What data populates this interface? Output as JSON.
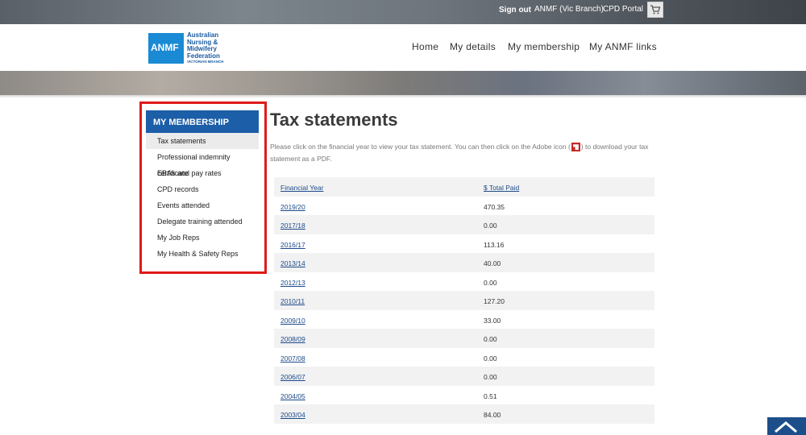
{
  "topbar": {
    "sign_out": "Sign out",
    "branch_link": "ANMF (Vic Branch)",
    "cpd_link": "CPD Portal",
    "cart_icon": "cart-icon"
  },
  "logo": {
    "abbr": "ANMF",
    "line1": "Australian",
    "line2": "Nursing &",
    "line3": "Midwifery",
    "line4": "Federation",
    "branch": "VICTORIAN BRANCH"
  },
  "nav": {
    "home": "Home",
    "my_details": "My details",
    "my_membership": "My membership",
    "my_anmf_links": "My ANMF links"
  },
  "sidebar": {
    "heading": "MY MEMBERSHIP",
    "items": [
      {
        "label": "Tax statements",
        "active": true
      },
      {
        "label": "Professional indemnity certificate"
      },
      {
        "label": "EBAs and pay rates"
      },
      {
        "label": "CPD records"
      },
      {
        "label": "Events attended"
      },
      {
        "label": "Delegate training attended"
      },
      {
        "label": "My Job Reps"
      },
      {
        "label": "My Health & Safety Reps"
      }
    ]
  },
  "main": {
    "title": "Tax statements",
    "intro_before": "Please click on the financial year to view your tax statement. You can then click on the Adobe icon (",
    "intro_after": ") to download your tax statement as a PDF."
  },
  "table": {
    "headers": [
      "Financial Year",
      "$ Total Paid"
    ],
    "rows": [
      [
        "2019/20",
        "470.35"
      ],
      [
        "2017/18",
        "0.00"
      ],
      [
        "2016/17",
        "113.16"
      ],
      [
        "2013/14",
        "40.00"
      ],
      [
        "2012/13",
        "0.00"
      ],
      [
        "2010/11",
        "127.20"
      ],
      [
        "2009/10",
        "33.00"
      ],
      [
        "2008/09",
        "0.00"
      ],
      [
        "2007/08",
        "0.00"
      ],
      [
        "2006/07",
        "0.00"
      ],
      [
        "2004/05",
        "0.51"
      ],
      [
        "2003/04",
        "84.00"
      ]
    ]
  },
  "colors": {
    "brand_blue": "#1c5ea8",
    "highlight_red": "#e01a1a",
    "link_blue": "#1c4a8a"
  }
}
